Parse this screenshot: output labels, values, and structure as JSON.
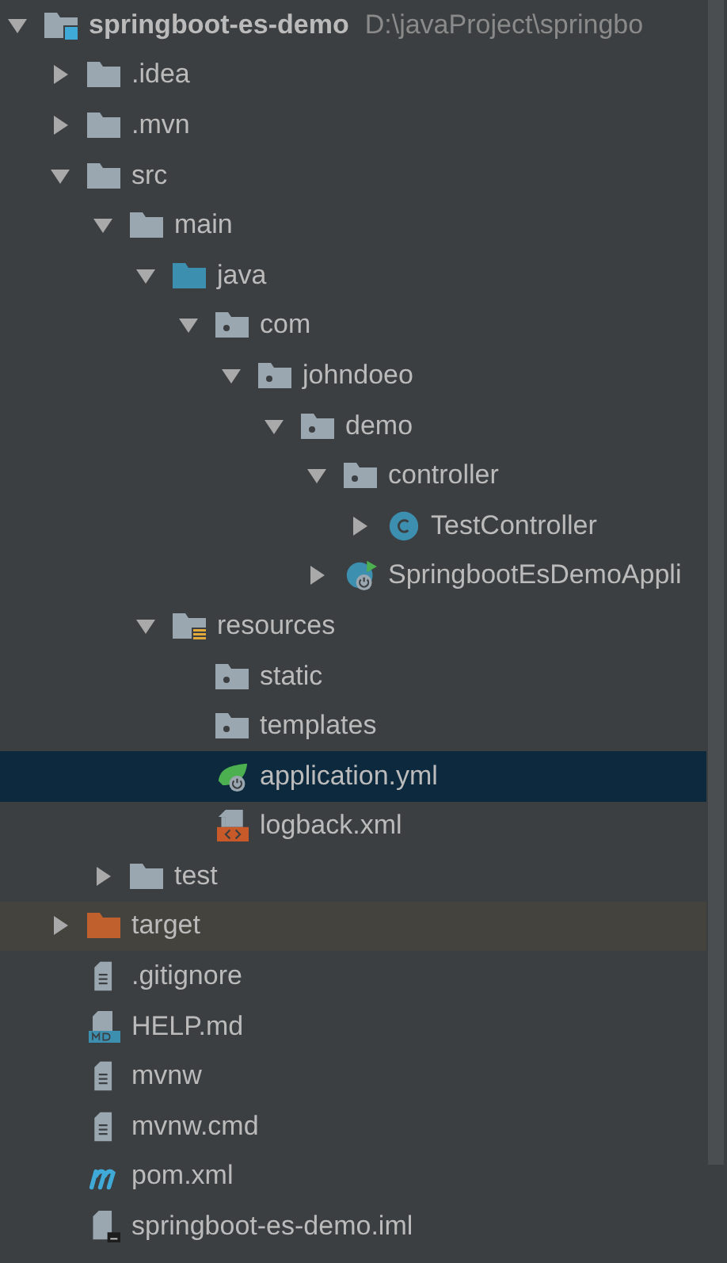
{
  "project_tree": [
    {
      "label": "springboot-es-demo",
      "path": "D:\\javaProject\\springbo",
      "kind": "project",
      "expanded": true,
      "selected": false,
      "children": [
        {
          "label": ".idea",
          "kind": "folder",
          "expanded": false,
          "selected": false
        },
        {
          "label": ".mvn",
          "kind": "folder",
          "expanded": false,
          "selected": false
        },
        {
          "label": "src",
          "kind": "folder",
          "expanded": true,
          "selected": false,
          "children": [
            {
              "label": "main",
              "kind": "folder",
              "expanded": true,
              "selected": false,
              "children": [
                {
                  "label": "java",
                  "kind": "source-folder",
                  "expanded": true,
                  "selected": false,
                  "children": [
                    {
                      "label": "com",
                      "kind": "package",
                      "expanded": true,
                      "selected": false,
                      "children": [
                        {
                          "label": "johndoeo",
                          "kind": "package",
                          "expanded": true,
                          "selected": false,
                          "children": [
                            {
                              "label": "demo",
                              "kind": "package",
                              "expanded": true,
                              "selected": false,
                              "children": [
                                {
                                  "label": "controller",
                                  "kind": "package",
                                  "expanded": true,
                                  "selected": false,
                                  "children": [
                                    {
                                      "label": "TestController",
                                      "kind": "class",
                                      "expanded": false,
                                      "selected": false
                                    }
                                  ]
                                },
                                {
                                  "label": "SpringbootEsDemoAppli",
                                  "kind": "spring-app",
                                  "expanded": false,
                                  "selected": false
                                }
                              ]
                            }
                          ]
                        }
                      ]
                    }
                  ]
                },
                {
                  "label": "resources",
                  "kind": "resource-folder",
                  "expanded": true,
                  "selected": false,
                  "children": [
                    {
                      "label": "static",
                      "kind": "package",
                      "selected": false
                    },
                    {
                      "label": "templates",
                      "kind": "package",
                      "selected": false
                    },
                    {
                      "label": "application.yml",
                      "kind": "spring-config",
                      "selected": true
                    },
                    {
                      "label": "logback.xml",
                      "kind": "xml",
                      "selected": false
                    }
                  ]
                }
              ]
            },
            {
              "label": "test",
              "kind": "folder",
              "expanded": false,
              "selected": false
            }
          ]
        },
        {
          "label": "target",
          "kind": "excluded-folder",
          "expanded": false,
          "selected": false
        },
        {
          "label": ".gitignore",
          "kind": "text",
          "selected": false
        },
        {
          "label": "HELP.md",
          "kind": "markdown",
          "selected": false
        },
        {
          "label": "mvnw",
          "kind": "text",
          "selected": false
        },
        {
          "label": "mvnw.cmd",
          "kind": "text",
          "selected": false
        },
        {
          "label": "pom.xml",
          "kind": "maven",
          "selected": false
        },
        {
          "label": "springboot-es-demo.iml",
          "kind": "module",
          "selected": false
        }
      ]
    }
  ]
}
